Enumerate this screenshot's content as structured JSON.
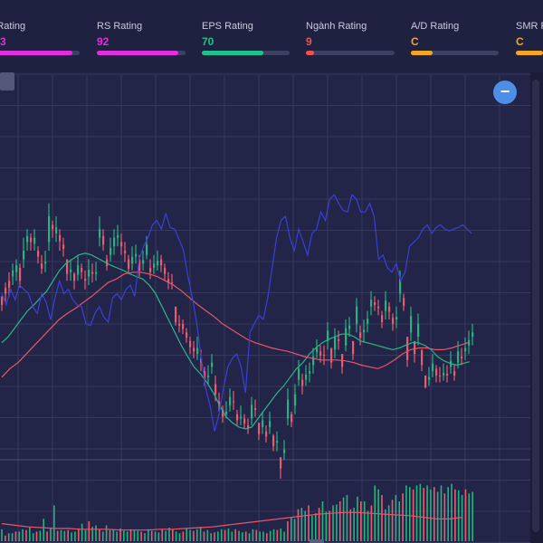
{
  "ratings": [
    {
      "label": "om Rating",
      "value": "3",
      "color": "#e12ee0",
      "fraction": 0.93
    },
    {
      "label": "RS Rating",
      "value": "92",
      "color": "#e12ee0",
      "fraction": 0.92
    },
    {
      "label": "EPS Rating",
      "value": "70",
      "color": "#1fc28a",
      "fraction": 0.7
    },
    {
      "label": "Ngành Rating",
      "value": "9",
      "color": "#ef5350",
      "fraction": 0.09
    },
    {
      "label": "A/D Rating",
      "value": "C",
      "color": "#f5a524",
      "fraction": 0.25
    },
    {
      "label": "SMR Ra",
      "value": "C",
      "color": "#f5a524",
      "fraction": 0.4
    }
  ],
  "controls": {
    "zoom_out_symbol": "−"
  },
  "colors": {
    "up": "#26b37f",
    "down": "#ef5a6a",
    "ma_fast": "#2bb58a",
    "ma_slow": "#e9556a",
    "rs_line": "#3a3fd8",
    "volume_ma": "#e9556a",
    "grid": "#37395c"
  },
  "chart_data": {
    "type": "candlestick",
    "title": "",
    "xlabel": "",
    "ylabel": "",
    "grid": true,
    "price": {
      "close": [
        268,
        255,
        248,
        228,
        222,
        240,
        205,
        188,
        195,
        190,
        212,
        226,
        218,
        165,
        180,
        178,
        194,
        203,
        232,
        227,
        240,
        222,
        230,
        240,
        227,
        232,
        230,
        180,
        198,
        223,
        202,
        190,
        187,
        200,
        208,
        226,
        212,
        209,
        228,
        216,
        198,
        230,
        220,
        217,
        222,
        232,
        242,
        242,
        288,
        292,
        296,
        306,
        317,
        322,
        318,
        335,
        354,
        350,
        335,
        372,
        384,
        398,
        392,
        375,
        381,
        402,
        398,
        406,
        412,
        384,
        390,
        418,
        402,
        421,
        403,
        432,
        426,
        458,
        436,
        378,
        404,
        372,
        342,
        362,
        349,
        345,
        328,
        318,
        327,
        326,
        298,
        335,
        305,
        310,
        340,
        295,
        292,
        325,
        270,
        306,
        297,
        284,
        262,
        268,
        272,
        288,
        263,
        276,
        290,
        282,
        238,
        269,
        332,
        281,
        325,
        290,
        338,
        364,
        352,
        336,
        350,
        350,
        347,
        350,
        333,
        350,
        322,
        330,
        318,
        309,
        300
      ],
      "open": [
        258,
        248,
        240,
        235,
        230,
        225,
        215,
        195,
        190,
        197,
        205,
        220,
        220,
        195,
        175,
        185,
        187,
        198,
        215,
        230,
        232,
        233,
        225,
        238,
        235,
        230,
        232,
        190,
        188,
        215,
        210,
        200,
        190,
        195,
        205,
        215,
        220,
        212,
        215,
        220,
        210,
        225,
        225,
        222,
        215,
        225,
        238,
        242,
        270,
        290,
        290,
        300,
        310,
        318,
        325,
        330,
        345,
        352,
        340,
        360,
        380,
        390,
        395,
        385,
        380,
        395,
        400,
        400,
        408,
        400,
        388,
        405,
        410,
        415,
        410,
        420,
        428,
        445,
        440,
        400,
        395,
        385,
        355,
        355,
        355,
        348,
        338,
        323,
        322,
        326,
        310,
        318,
        320,
        308,
        325,
        315,
        296,
        310,
        290,
        300,
        300,
        290,
        270,
        265,
        270,
        280,
        275,
        270,
        283,
        285,
        255,
        260,
        305,
        300,
        310,
        305,
        320,
        350,
        355,
        345,
        342,
        350,
        350,
        348,
        340,
        345,
        335,
        328,
        322,
        315,
        305
      ],
      "high": [
        260,
        242,
        230,
        220,
        215,
        220,
        190,
        180,
        185,
        180,
        200,
        210,
        205,
        150,
        170,
        165,
        180,
        190,
        220,
        215,
        230,
        210,
        220,
        228,
        215,
        220,
        218,
        165,
        180,
        210,
        190,
        180,
        175,
        185,
        195,
        210,
        200,
        198,
        210,
        205,
        188,
        215,
        210,
        205,
        210,
        220,
        230,
        232,
        270,
        280,
        285,
        295,
        305,
        310,
        305,
        320,
        340,
        338,
        325,
        350,
        370,
        385,
        380,
        365,
        368,
        390,
        385,
        395,
        400,
        375,
        378,
        405,
        392,
        408,
        392,
        418,
        415,
        445,
        425,
        365,
        392,
        360,
        332,
        348,
        338,
        335,
        318,
        308,
        315,
        315,
        288,
        322,
        295,
        298,
        325,
        285,
        282,
        312,
        260,
        292,
        285,
        275,
        252,
        258,
        262,
        275,
        252,
        265,
        278,
        270,
        228,
        255,
        318,
        270,
        312,
        278,
        325,
        350,
        340,
        325,
        338,
        340,
        336,
        338,
        322,
        338,
        310,
        318,
        306,
        298,
        290
      ],
      "low": [
        275,
        265,
        258,
        245,
        240,
        248,
        225,
        205,
        205,
        205,
        220,
        232,
        230,
        205,
        190,
        195,
        205,
        212,
        240,
        240,
        250,
        240,
        238,
        250,
        245,
        242,
        240,
        200,
        205,
        228,
        218,
        210,
        200,
        210,
        218,
        232,
        228,
        220,
        235,
        228,
        215,
        238,
        232,
        228,
        230,
        240,
        250,
        250,
        292,
        300,
        302,
        312,
        325,
        330,
        332,
        345,
        362,
        360,
        348,
        380,
        392,
        405,
        400,
        392,
        390,
        408,
        408,
        412,
        418,
        408,
        398,
        425,
        418,
        428,
        418,
        438,
        438,
        470,
        448,
        408,
        410,
        395,
        362,
        372,
        362,
        358,
        348,
        330,
        335,
        338,
        320,
        342,
        330,
        320,
        348,
        322,
        305,
        332,
        300,
        315,
        312,
        300,
        280,
        275,
        280,
        295,
        285,
        285,
        298,
        295,
        265,
        275,
        340,
        310,
        335,
        315,
        345,
        365,
        362,
        352,
        358,
        358,
        356,
        358,
        348,
        356,
        342,
        338,
        332,
        325,
        315
      ]
    },
    "ma_fast": [
      312,
      305,
      295,
      285,
      275,
      268,
      260,
      252,
      240,
      228,
      220,
      215,
      210,
      208,
      210,
      214,
      218,
      222,
      225,
      228,
      232,
      235,
      238,
      245,
      255,
      270,
      285,
      300,
      315,
      328,
      340,
      348,
      358,
      370,
      385,
      398,
      405,
      410,
      412,
      410,
      400,
      390,
      380,
      370,
      362,
      352,
      342,
      335,
      325,
      318,
      312,
      308,
      305,
      302,
      302,
      305,
      310,
      312,
      314,
      316,
      318,
      320,
      318,
      315,
      312,
      312,
      315,
      320,
      328,
      333,
      336,
      338,
      336,
      334
    ],
    "ma_slow": [
      352,
      342,
      335,
      325,
      315,
      305,
      295,
      285,
      278,
      272,
      265,
      258,
      250,
      242,
      238,
      232,
      230,
      230,
      232,
      235,
      240,
      245,
      252,
      260,
      268,
      275,
      282,
      290,
      296,
      302,
      308,
      312,
      315,
      318,
      320,
      322,
      325,
      328,
      330,
      332,
      332,
      332,
      333,
      335,
      338,
      340,
      342,
      338,
      332,
      325,
      320,
      318,
      318,
      320,
      320,
      318,
      315,
      312
    ],
    "rs_line": [
      255,
      268,
      250,
      262,
      245,
      250,
      255,
      270,
      278,
      255,
      265,
      285,
      260,
      240,
      255,
      250,
      262,
      268,
      270,
      290,
      292,
      278,
      270,
      282,
      288,
      260,
      255,
      262,
      250,
      245,
      258,
      215,
      200,
      190,
      175,
      170,
      180,
      162,
      178,
      180,
      192,
      205,
      235,
      260,
      290,
      330,
      365,
      385,
      415,
      395,
      365,
      340,
      330,
      325,
      340,
      370,
      300,
      290,
      280,
      285,
      260,
      225,
      190,
      170,
      165,
      190,
      205,
      180,
      195,
      210,
      185,
      180,
      160,
      170,
      145,
      140,
      150,
      158,
      160,
      140,
      145,
      160,
      160,
      150,
      165,
      215,
      210,
      225,
      230,
      220,
      240,
      230,
      200,
      195,
      190,
      180,
      175,
      185,
      178,
      175,
      180,
      182,
      180,
      178,
      175,
      180,
      185
    ]
  },
  "volume_data": {
    "values": [
      85,
      93,
      90,
      90,
      88,
      88,
      85,
      86,
      82,
      90,
      88,
      87,
      72,
      88,
      83,
      55,
      87,
      86,
      87,
      86,
      89,
      88,
      84,
      78,
      86,
      75,
      82,
      80,
      85,
      88,
      80,
      86,
      85,
      88,
      84,
      87,
      88,
      85,
      86,
      87,
      88,
      90,
      85,
      87,
      88,
      89,
      85,
      87,
      83,
      85,
      88,
      90,
      88,
      84,
      86,
      87,
      85,
      82,
      88,
      86,
      90,
      89,
      88,
      85,
      86,
      84,
      88,
      85,
      87,
      89,
      88,
      90,
      85,
      86,
      88,
      88,
      90,
      87,
      85,
      86,
      84,
      88,
      75,
      70,
      72,
      60,
      58,
      62,
      55,
      68,
      65,
      58,
      50,
      63,
      62,
      55,
      54,
      50,
      45,
      42,
      60,
      58,
      44,
      50,
      50,
      62,
      55,
      30,
      35,
      42,
      60,
      55,
      48,
      42,
      50,
      40,
      30,
      32,
      35,
      30,
      28,
      33,
      30,
      35,
      32,
      38,
      30,
      40,
      32,
      28,
      35,
      36,
      42,
      35,
      40,
      38
    ],
    "ma": [
      78,
      80,
      82,
      83,
      84,
      84,
      85,
      85,
      85,
      86,
      86,
      86,
      85,
      85,
      84,
      83,
      82,
      80,
      78,
      76,
      74,
      72,
      70,
      68,
      66,
      65,
      64,
      64,
      65,
      66,
      67,
      68,
      70,
      72,
      72,
      70
    ]
  }
}
